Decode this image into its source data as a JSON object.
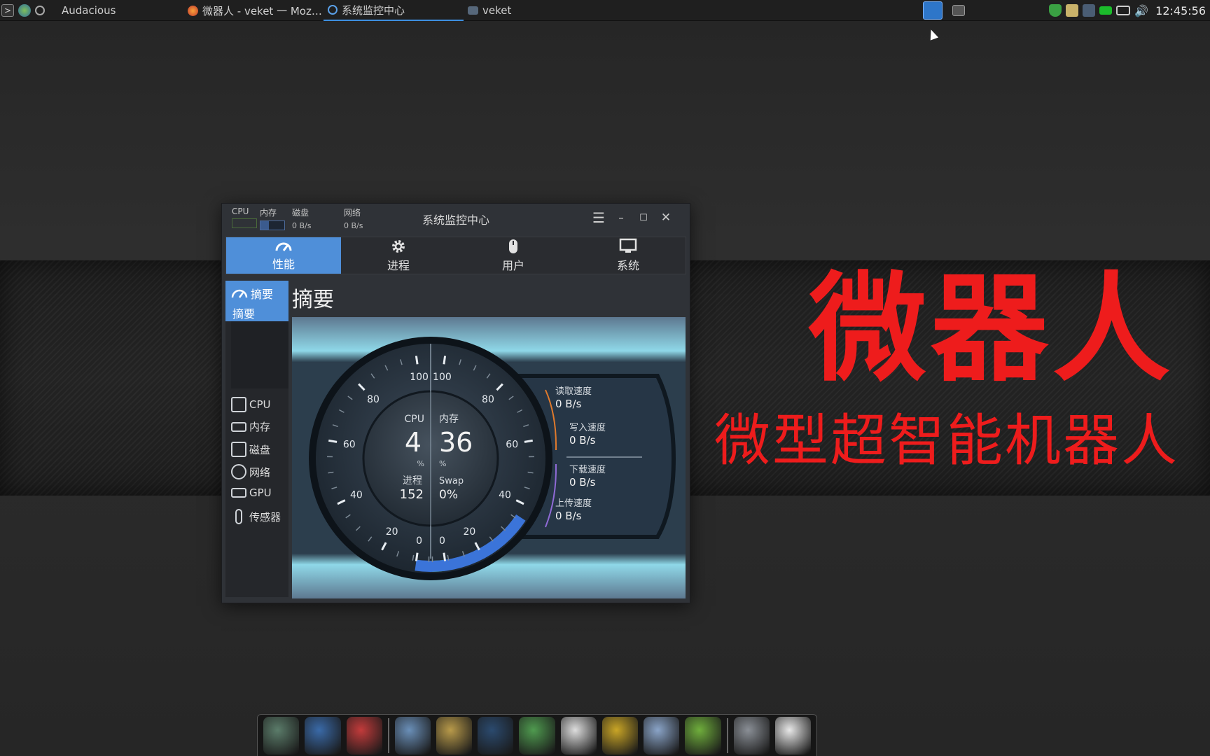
{
  "taskbar": {
    "tasks": [
      {
        "label": "Audacious"
      },
      {
        "label": "微器人 - veket 一 Moz…"
      },
      {
        "label": "系统监控中心"
      },
      {
        "label": "veket"
      }
    ],
    "clock": "12:45:56"
  },
  "wallpaper": {
    "title": "微器人",
    "subtitle": "微型超智能机器人"
  },
  "window": {
    "title": "系统监控中心",
    "mini_monitor": {
      "cpu_label": "CPU",
      "mem_label": "内存",
      "disk_label": "磁盘",
      "disk_value": "0 B/s",
      "net_label": "网络",
      "net_value": "0 B/s"
    },
    "tabs": [
      {
        "label": "性能",
        "icon": "gauge-icon"
      },
      {
        "label": "进程",
        "icon": "gear-icon"
      },
      {
        "label": "用户",
        "icon": "mouse-icon"
      },
      {
        "label": "系统",
        "icon": "monitor-icon"
      }
    ],
    "sidebar": {
      "selected": "摘要",
      "sub_selected": "摘要",
      "items": [
        {
          "label": "CPU",
          "icon": "cpu-icon"
        },
        {
          "label": "内存",
          "icon": "memory-icon"
        },
        {
          "label": "磁盘",
          "icon": "disk-icon"
        },
        {
          "label": "网络",
          "icon": "globe-icon"
        },
        {
          "label": "GPU",
          "icon": "gpu-icon"
        },
        {
          "label": "传感器",
          "icon": "thermometer-icon"
        }
      ]
    },
    "content_title": "摘要",
    "gauge": {
      "left_ticks": [
        "0",
        "20",
        "40",
        "60",
        "80",
        "100"
      ],
      "right_ticks": [
        "0",
        "20",
        "40",
        "60",
        "80",
        "100"
      ],
      "cpu": {
        "label": "CPU",
        "value": "4",
        "unit": "%",
        "percent": 4
      },
      "memory": {
        "label": "内存",
        "value": "36",
        "unit": "%",
        "percent": 36
      },
      "process": {
        "label": "进程",
        "value": "152"
      },
      "swap": {
        "label": "Swap",
        "value": "0%"
      },
      "io": [
        {
          "label": "读取速度",
          "value": "0 B/s"
        },
        {
          "label": "写入速度",
          "value": "0 B/s"
        },
        {
          "label": "下载速度",
          "value": "0 B/s"
        },
        {
          "label": "上传速度",
          "value": "0 B/s"
        }
      ]
    }
  },
  "dock": {
    "items": [
      "file-manager-icon",
      "monitor-icon",
      "squirrel-icon",
      "notepad-icon",
      "paint-icon",
      "scanner-icon",
      "network-users-icon",
      "penguin-icon",
      "book-icon",
      "chart-icon",
      "help-icon",
      "drive-icon",
      "brightness-icon"
    ]
  },
  "colors": {
    "accent": "#4f8fd9",
    "wallpaper_text": "#ee1c1c"
  }
}
